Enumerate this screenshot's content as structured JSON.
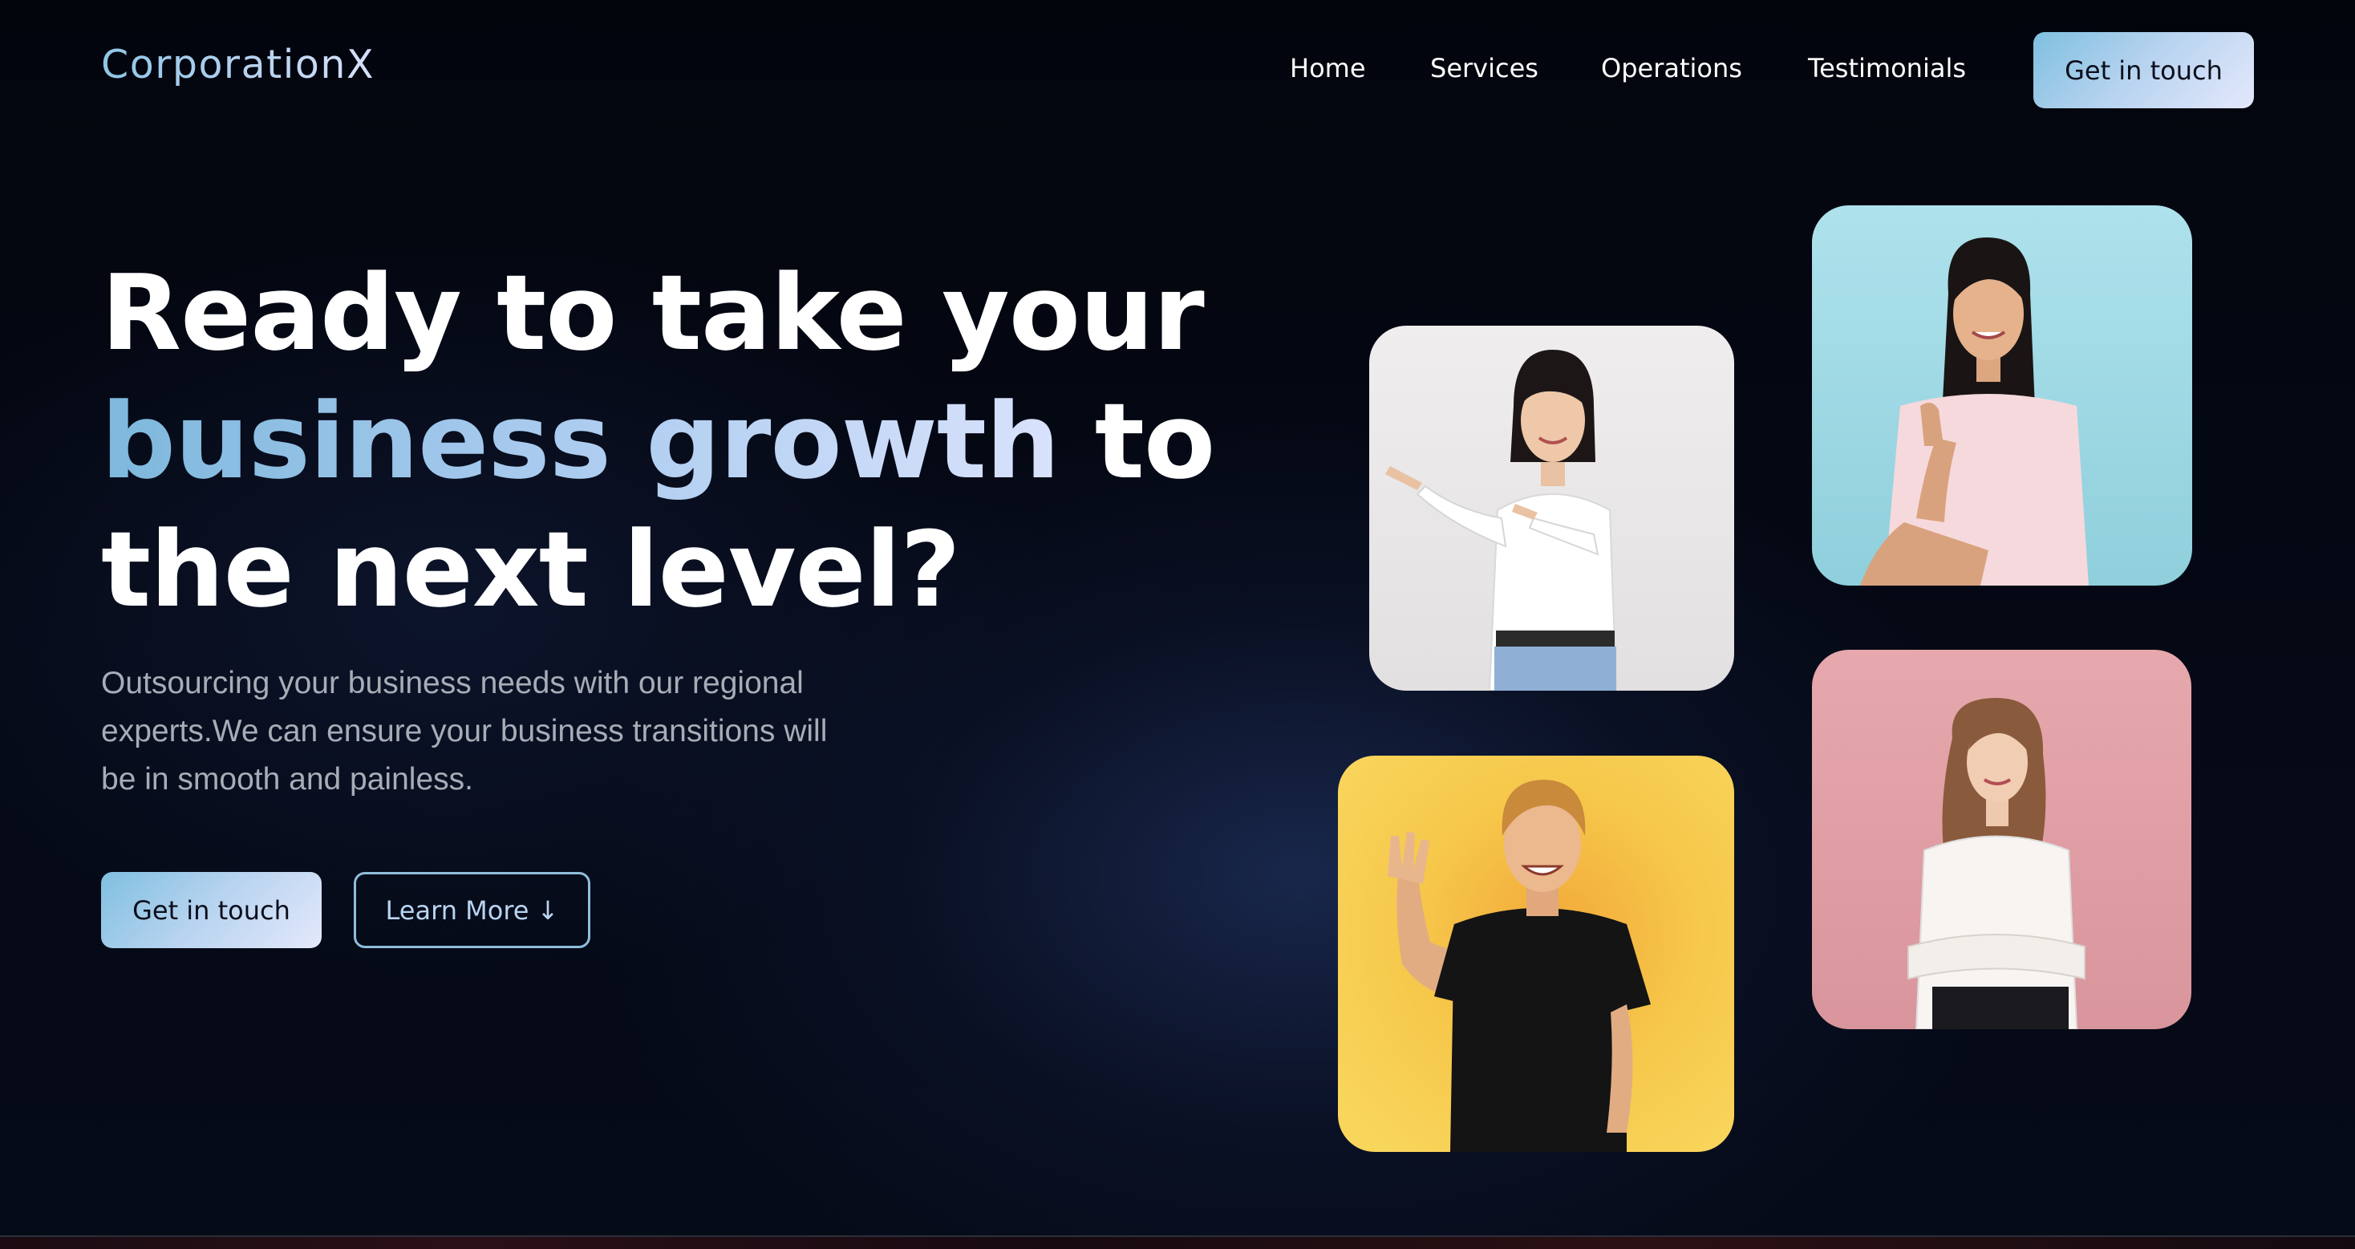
{
  "nav": {
    "brand": "CorporationX",
    "links": [
      "Home",
      "Services",
      "Operations",
      "Testimonials"
    ],
    "cta": "Get in touch"
  },
  "hero": {
    "headline": {
      "line1": "Ready to take your",
      "line2_highlight": "business growth",
      "line2_rest": " to",
      "line3": "the next level?"
    },
    "subtext": "Outsourcing your business needs with our regional experts.We can ensure your business transitions will be in smooth and painless.",
    "primary_cta": "Get in touch",
    "secondary_cta": "Learn More ↓"
  },
  "colors": {
    "background": "#02040c",
    "accent_gradient_start": "#7fbfe0",
    "accent_gradient_end": "#e4e8fb",
    "photo_bg_white": "#eceaea",
    "photo_bg_blue": "#a9dde8",
    "photo_bg_pink": "#e3a4aa",
    "photo_bg_yellow": "#f5c84a"
  },
  "photos": [
    {
      "name": "woman-pointing-photo",
      "background": "white"
    },
    {
      "name": "woman-thumbs-up-photo",
      "background": "light-blue"
    },
    {
      "name": "woman-arms-crossed-photo",
      "background": "pink"
    },
    {
      "name": "man-waving-photo",
      "background": "yellow"
    }
  ]
}
